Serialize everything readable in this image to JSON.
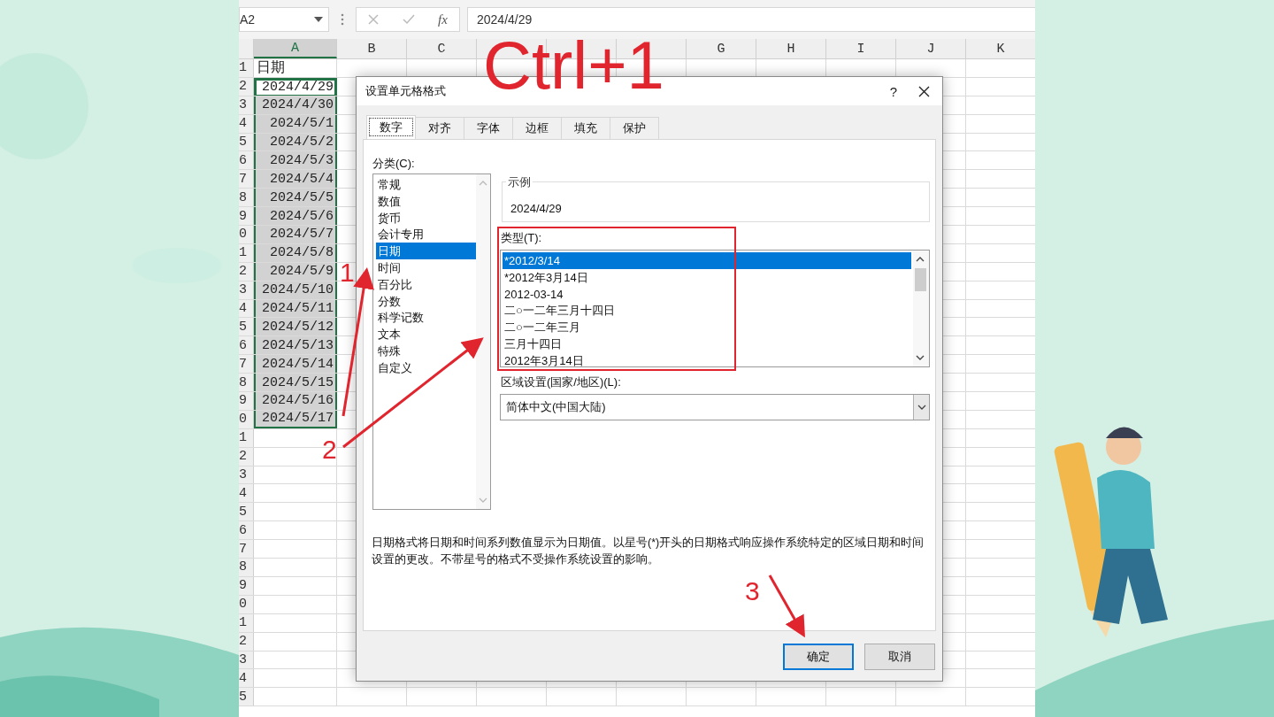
{
  "formula_bar": {
    "name_box": "A2",
    "fx_label": "fx",
    "value": "2024/4/29"
  },
  "sheet": {
    "columns": [
      {
        "label": "A",
        "selected": true
      },
      {
        "label": "B",
        "selected": false
      },
      {
        "label": "C",
        "selected": false
      },
      {
        "selected": false
      },
      {
        "selected": false
      },
      {
        "selected": false
      },
      {
        "label": "G",
        "selected": false
      },
      {
        "label": "H",
        "selected": false
      },
      {
        "label": "I",
        "selected": false
      },
      {
        "label": "J",
        "selected": false
      },
      {
        "label": "K",
        "selected": false
      }
    ],
    "rows": [
      {
        "number": "1",
        "cell_a": "日期",
        "selected": false,
        "active": false
      },
      {
        "number": "2",
        "cell_a": "2024/4/29",
        "selected": true,
        "active": true
      },
      {
        "number": "3",
        "cell_a": "2024/4/30",
        "selected": true,
        "active": false
      },
      {
        "number": "4",
        "cell_a": "2024/5/1",
        "selected": true,
        "active": false
      },
      {
        "number": "5",
        "cell_a": "2024/5/2",
        "selected": true,
        "active": false
      },
      {
        "number": "6",
        "cell_a": "2024/5/3",
        "selected": true,
        "active": false
      },
      {
        "number": "7",
        "cell_a": "2024/5/4",
        "selected": true,
        "active": false
      },
      {
        "number": "8",
        "cell_a": "2024/5/5",
        "selected": true,
        "active": false
      },
      {
        "number": "9",
        "cell_a": "2024/5/6",
        "selected": true,
        "active": false
      },
      {
        "number": "0",
        "cell_a": "2024/5/7",
        "selected": true,
        "active": false
      },
      {
        "number": "1",
        "cell_a": "2024/5/8",
        "selected": true,
        "active": false
      },
      {
        "number": "2",
        "cell_a": "2024/5/9",
        "selected": true,
        "active": false
      },
      {
        "number": "3",
        "cell_a": "2024/5/10",
        "selected": true,
        "active": false
      },
      {
        "number": "4",
        "cell_a": "2024/5/11",
        "selected": true,
        "active": false
      },
      {
        "number": "5",
        "cell_a": "2024/5/12",
        "selected": true,
        "active": false
      },
      {
        "number": "6",
        "cell_a": "2024/5/13",
        "selected": true,
        "active": false
      },
      {
        "number": "7",
        "cell_a": "2024/5/14",
        "selected": true,
        "active": false
      },
      {
        "number": "8",
        "cell_a": "2024/5/15",
        "selected": true,
        "active": false
      },
      {
        "number": "9",
        "cell_a": "2024/5/16",
        "selected": true,
        "active": false
      },
      {
        "number": "0",
        "cell_a": "2024/5/17",
        "selected": true,
        "active": false
      },
      {
        "number": "1",
        "selected": false,
        "active": false
      },
      {
        "number": "2",
        "selected": false,
        "active": false
      },
      {
        "number": "3",
        "selected": false,
        "active": false
      },
      {
        "number": "4",
        "selected": false,
        "active": false
      },
      {
        "number": "5",
        "selected": false,
        "active": false
      },
      {
        "number": "6",
        "selected": false,
        "active": false
      },
      {
        "number": "7",
        "selected": false,
        "active": false
      },
      {
        "number": "8",
        "selected": false,
        "active": false
      },
      {
        "number": "9",
        "selected": false,
        "active": false
      },
      {
        "number": "0",
        "selected": false,
        "active": false
      },
      {
        "number": "1",
        "selected": false,
        "active": false
      },
      {
        "number": "2",
        "selected": false,
        "active": false
      },
      {
        "number": "3",
        "selected": false,
        "active": false
      },
      {
        "number": "4",
        "selected": false,
        "active": false
      },
      {
        "number": "5",
        "selected": false,
        "active": false
      }
    ]
  },
  "dialog": {
    "title": "设置单元格格式",
    "help": "?",
    "tabs": [
      {
        "label": "数字",
        "selected": true
      },
      {
        "label": "对齐",
        "selected": false
      },
      {
        "label": "字体",
        "selected": false
      },
      {
        "label": "边框",
        "selected": false
      },
      {
        "label": "填充",
        "selected": false
      },
      {
        "label": "保护",
        "selected": false
      }
    ],
    "category_label": "分类(C):",
    "categories": [
      {
        "label": "常规",
        "selected": false
      },
      {
        "label": "数值",
        "selected": false
      },
      {
        "label": "货币",
        "selected": false
      },
      {
        "label": "会计专用",
        "selected": false
      },
      {
        "label": "日期",
        "selected": true
      },
      {
        "label": "时间",
        "selected": false
      },
      {
        "label": "百分比",
        "selected": false
      },
      {
        "label": "分数",
        "selected": false
      },
      {
        "label": "科学记数",
        "selected": false
      },
      {
        "label": "文本",
        "selected": false
      },
      {
        "label": "特殊",
        "selected": false
      },
      {
        "label": "自定义",
        "selected": false
      }
    ],
    "sample": {
      "label": "示例",
      "value": "2024/4/29"
    },
    "type_label": "类型(T):",
    "types": [
      {
        "label": "*2012/3/14",
        "selected": true
      },
      {
        "label": "*2012年3月14日",
        "selected": false
      },
      {
        "label": "2012-03-14",
        "selected": false
      },
      {
        "label": "二○一二年三月十四日",
        "selected": false
      },
      {
        "label": "二○一二年三月",
        "selected": false
      },
      {
        "label": "三月十四日",
        "selected": false
      },
      {
        "label": "2012年3月14日",
        "selected": false
      }
    ],
    "locale_label": "区域设置(国家/地区)(L):",
    "locale_value": "简体中文(中国大陆)",
    "description": "日期格式将日期和时间系列数值显示为日期值。以星号(*)开头的日期格式响应操作系统特定的区域日期和时间设置的更改。不带星号的格式不受操作系统设置的影响。",
    "buttons": [
      {
        "label": "确定",
        "default": true
      },
      {
        "label": "取消",
        "default": false
      }
    ]
  },
  "annotations": {
    "shortcut": "Ctrl+1",
    "steps": [
      "1",
      "2",
      "3"
    ]
  }
}
